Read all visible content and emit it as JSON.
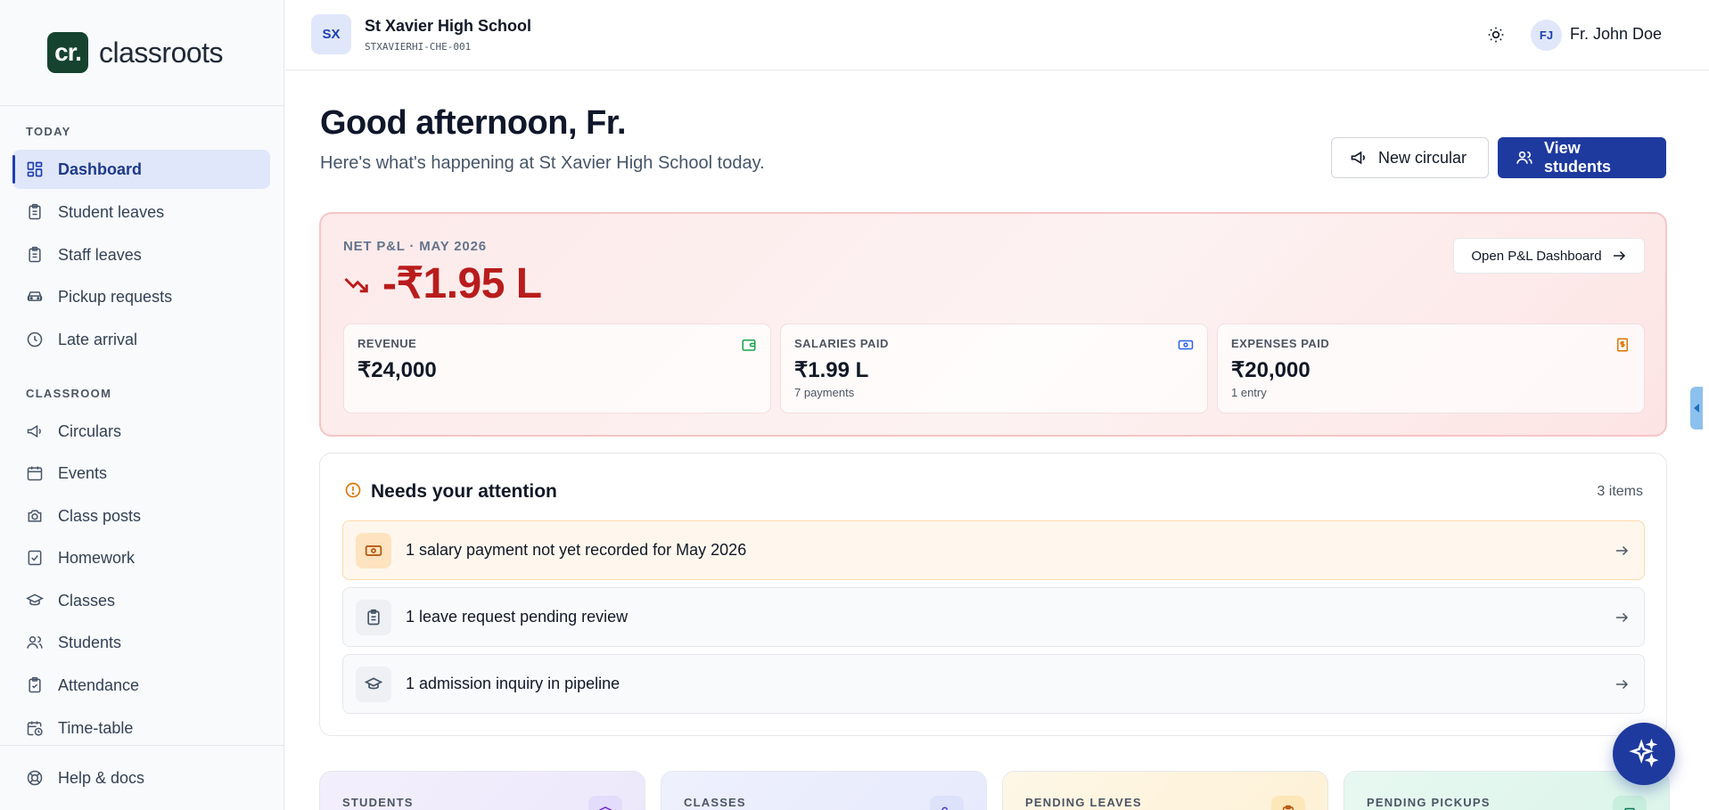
{
  "brand": {
    "mark": "cr.",
    "name": "classroots"
  },
  "sidebar": {
    "sections": [
      {
        "label": "TODAY"
      },
      {
        "label": "CLASSROOM"
      }
    ],
    "items": [
      {
        "label": "Dashboard",
        "icon": "dashboard-icon",
        "active": true
      },
      {
        "label": "Student leaves",
        "icon": "clipboard-icon"
      },
      {
        "label": "Staff leaves",
        "icon": "clipboard-icon"
      },
      {
        "label": "Pickup requests",
        "icon": "car-icon"
      },
      {
        "label": "Late arrival",
        "icon": "clock-icon"
      },
      {
        "label": "Circulars",
        "icon": "megaphone-icon"
      },
      {
        "label": "Events",
        "icon": "calendar-icon"
      },
      {
        "label": "Class posts",
        "icon": "camera-icon"
      },
      {
        "label": "Homework",
        "icon": "checklist-icon"
      },
      {
        "label": "Classes",
        "icon": "graduation-cap-icon"
      },
      {
        "label": "Students",
        "icon": "users-icon"
      },
      {
        "label": "Attendance",
        "icon": "clipboard-check-icon"
      },
      {
        "label": "Time-table",
        "icon": "calendar-clock-icon"
      }
    ],
    "help": {
      "label": "Help & docs",
      "icon": "lifebuoy-icon"
    }
  },
  "topbar": {
    "school_initials": "SX",
    "school_name": "St Xavier High School",
    "school_code": "STXAVIERHI-CHE-001",
    "user_initials": "FJ",
    "user_name": "Fr. John Doe"
  },
  "header": {
    "greeting": "Good afternoon, Fr.",
    "subtitle": "Here's what's happening at St Xavier High School today.",
    "new_circular": "New circular",
    "view_students": "View students"
  },
  "pl": {
    "label": "NET P&L · MAY 2026",
    "value": "-₹1.95 L",
    "open_button": "Open P&L Dashboard",
    "stats": [
      {
        "label": "REVENUE",
        "value": "₹24,000",
        "sub": "",
        "icon": "wallet-icon",
        "color": "#16a34a"
      },
      {
        "label": "SALARIES PAID",
        "value": "₹1.99 L",
        "sub": "7 payments",
        "icon": "banknote-icon",
        "color": "#2563eb"
      },
      {
        "label": "EXPENSES PAID",
        "value": "₹20,000",
        "sub": "1 entry",
        "icon": "receipt-icon",
        "color": "#d97706"
      }
    ]
  },
  "attention": {
    "title": "Needs your attention",
    "count": "3 items",
    "items": [
      {
        "text": "1 salary payment not yet recorded for May 2026",
        "icon": "banknote-icon",
        "tone": "warn"
      },
      {
        "text": "1 leave request pending review",
        "icon": "clipboard-icon",
        "tone": "neutral"
      },
      {
        "text": "1 admission inquiry in pipeline",
        "icon": "graduation-cap-icon",
        "tone": "neutral"
      }
    ]
  },
  "tiles": [
    {
      "label": "STUDENTS",
      "icon": "graduation-cap-icon"
    },
    {
      "label": "CLASSES",
      "icon": "users-icon"
    },
    {
      "label": "PENDING LEAVES",
      "icon": "clipboard-icon"
    },
    {
      "label": "PENDING PICKUPS",
      "icon": "car-icon"
    }
  ],
  "colors": {
    "primary": "#1e3a9f",
    "negative": "#b91c1c",
    "brand_green": "#16432f"
  }
}
